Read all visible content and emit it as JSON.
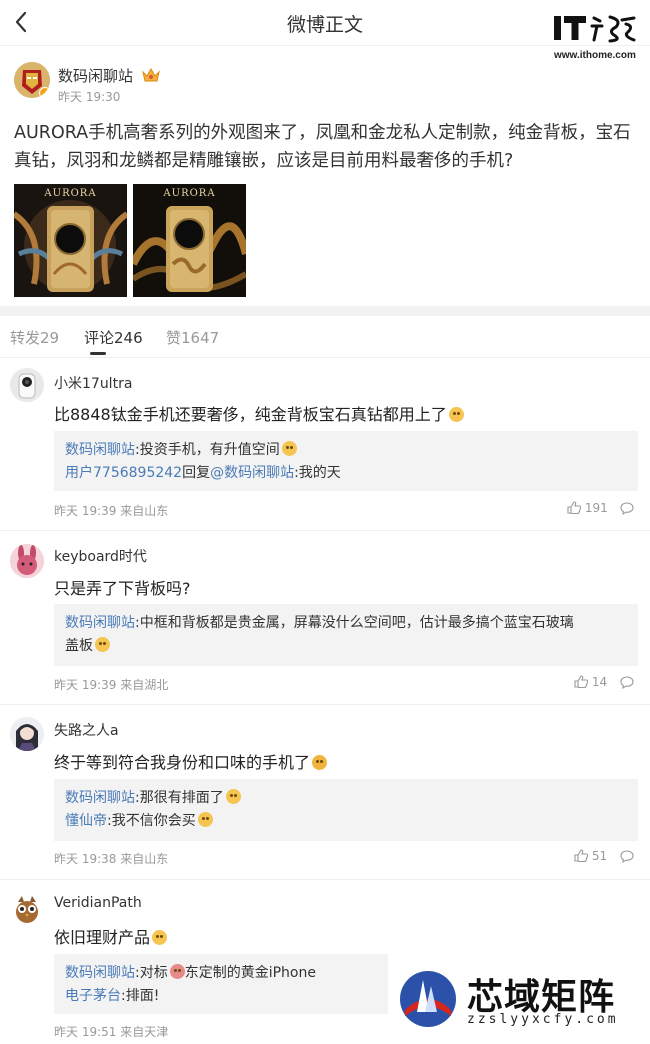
{
  "header": {
    "title": "微博正文",
    "logo_url": "www.ithome.com"
  },
  "post": {
    "author": "数码闲聊站",
    "time": "昨天 19:30",
    "text": "AURORA手机高奢系列的外观图来了，凤凰和金龙私人定制款，纯金背板，宝石真钻，凤羽和龙鳞都是精雕镶嵌，应该是目前用料最奢侈的手机?",
    "image_caption_1": "AURORA",
    "image_caption_2": "AURORA"
  },
  "tabs": {
    "repost": "转发29",
    "comments": "评论246",
    "likes": "赞1647"
  },
  "comments": [
    {
      "name": "小米17ultra",
      "text": "比8848钛金手机还要奢侈，纯金背板宝石真钻都用上了",
      "replies": [
        {
          "name": "数码闲聊站",
          "text": ":投资手机，有升值空间"
        },
        {
          "name": "用户7756895242",
          "text": "回复",
          "at": "@数码闲聊站",
          "tail": ":我的天"
        }
      ],
      "meta": "昨天 19:39 来自山东",
      "likes": "191"
    },
    {
      "name": "keyboard时代",
      "text": "只是弄了下背板吗?",
      "replies": [
        {
          "name": "数码闲聊站",
          "text": ":中框和背板都是贵金属，屏幕没什么空间吧，估计最多搞个蓝宝石玻璃",
          "text2": "盖板"
        }
      ],
      "meta": "昨天 19:39 来自湖北",
      "likes": "14"
    },
    {
      "name": "失路之人a",
      "text": "终于等到符合我身份和口味的手机了",
      "replies": [
        {
          "name": "数码闲聊站",
          "text": ":那很有排面了"
        },
        {
          "name": "懂仙帝",
          "text": ":我不信你会买"
        }
      ],
      "meta": "昨天 19:38 来自山东",
      "likes": "51"
    },
    {
      "name": "VeridianPath",
      "text": "依旧理财产品",
      "replies": [
        {
          "name": "数码闲聊站",
          "text": ":对标",
          "text_after": "东定制的黄金iPhone"
        },
        {
          "name": "电子茅台",
          "text": ":排面!"
        }
      ],
      "meta": "昨天 19:51 来自天津",
      "likes": ""
    }
  ],
  "watermark": {
    "brand": "芯域矩阵",
    "url": "zzslyyxcfy.com"
  }
}
